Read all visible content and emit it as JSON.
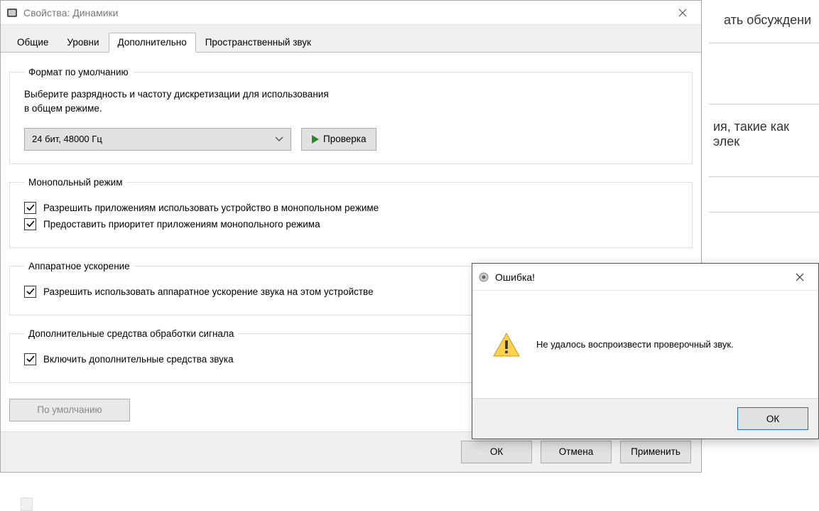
{
  "bg": {
    "t1": "ать обсуждени",
    "t2": "ия, такие как элек"
  },
  "window": {
    "title": "Свойства: Динамики"
  },
  "tabs": {
    "general": "Общие",
    "levels": "Уровни",
    "advanced": "Дополнительно",
    "spatial": "Пространственный звук"
  },
  "groups": {
    "default_format": {
      "legend": "Формат по умолчанию",
      "desc_l1": "Выберите разрядность и частоту дискретизации для использования",
      "desc_l2": "в общем режиме.",
      "combo": "24 бит, 48000 Гц",
      "test_btn": "Проверка"
    },
    "exclusive": {
      "legend": "Монопольный режим",
      "chk1": "Разрешить приложениям использовать устройство в монопольном режиме",
      "chk2": "Предоставить приоритет приложениям монопольного режима"
    },
    "hw_accel": {
      "legend": "Аппаратное ускорение",
      "chk1": "Разрешить использовать аппаратное ускорение звука на этом устройстве"
    },
    "enhancements": {
      "legend": "Дополнительные средства обработки сигнала",
      "chk1": "Включить дополнительные средства звука"
    },
    "defaults_btn": "По умолчанию"
  },
  "footer": {
    "ok": "ОК",
    "cancel": "Отмена",
    "apply": "Применить"
  },
  "error": {
    "title": "Ошибка!",
    "msg": "Не удалось воспроизвести проверочный звук.",
    "ok": "ОК"
  }
}
